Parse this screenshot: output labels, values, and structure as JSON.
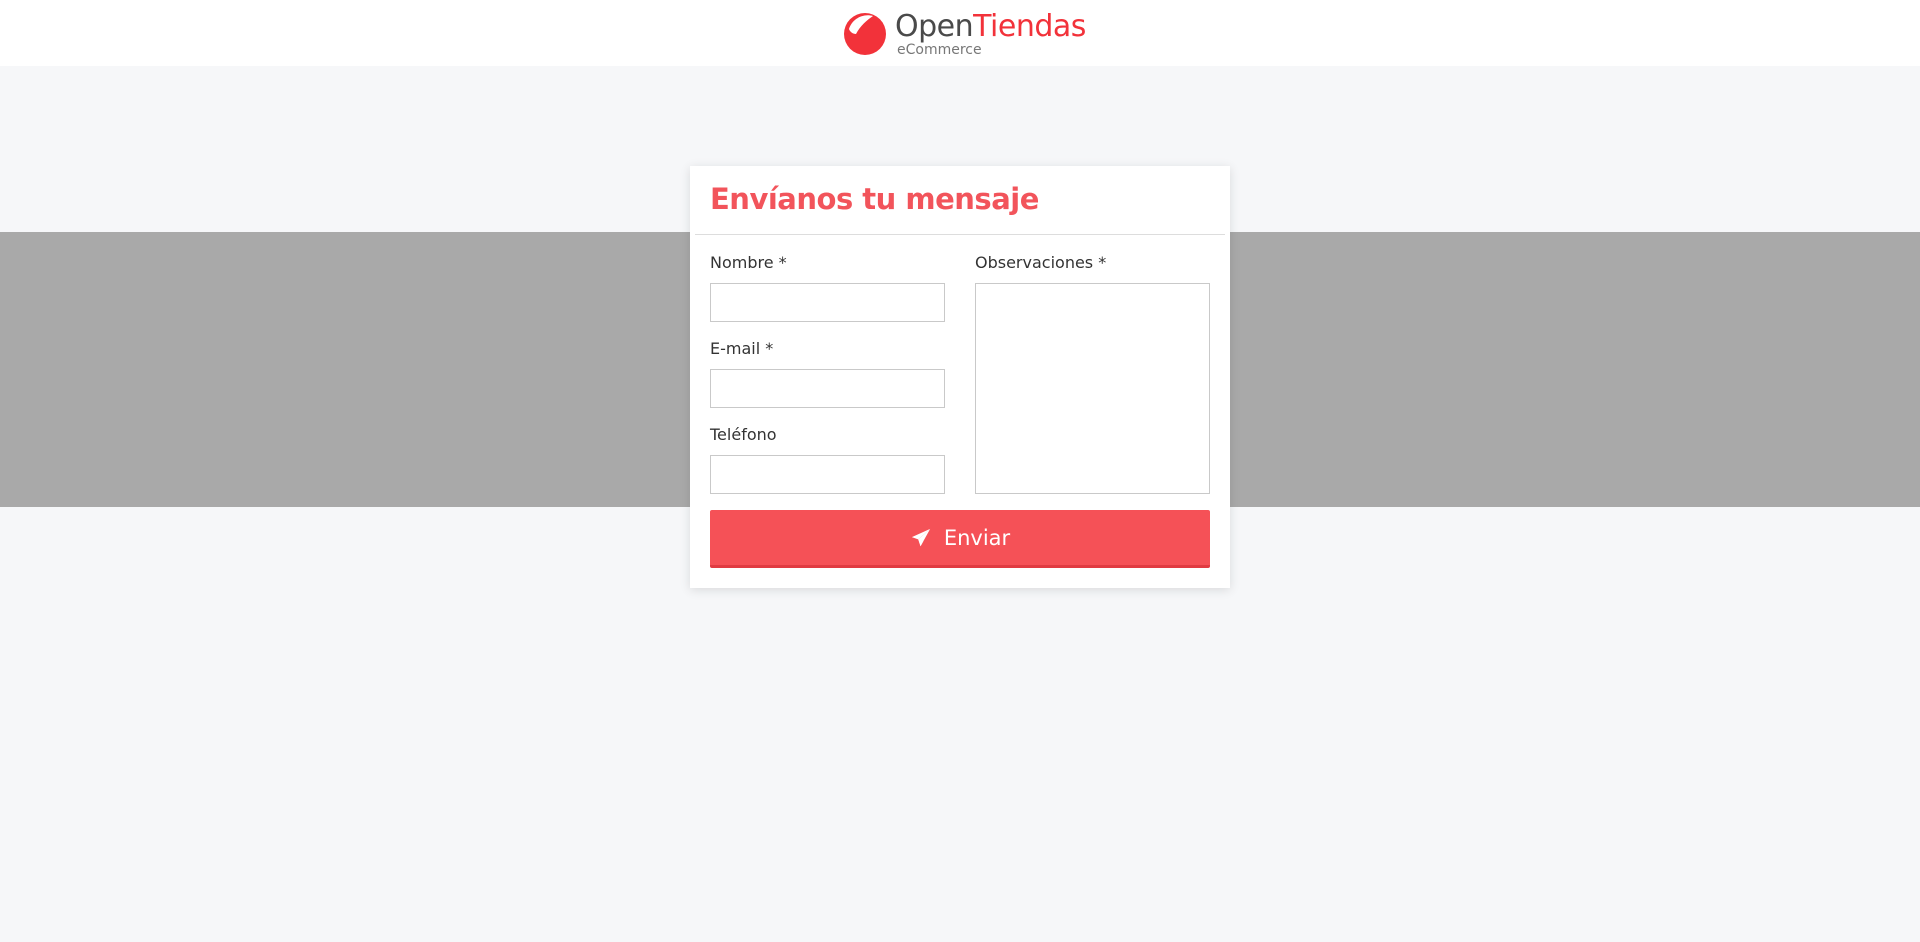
{
  "header": {
    "logo": {
      "name_part1": "Open",
      "name_part2": "Tiendas",
      "tagline": "eCommerce",
      "icon": "logo-mark",
      "colors": {
        "brand_red": "#f2323a",
        "text_dark": "#4a4a4a"
      }
    }
  },
  "form": {
    "title": "Envíanos tu mensaje",
    "fields": {
      "nombre": {
        "label": "Nombre *",
        "value": "",
        "placeholder": ""
      },
      "email": {
        "label": "E-mail *",
        "value": "",
        "placeholder": ""
      },
      "telefono": {
        "label": "Teléfono",
        "value": "",
        "placeholder": ""
      },
      "observaciones": {
        "label": "Observaciones *",
        "value": "",
        "placeholder": ""
      }
    },
    "submit": {
      "label": "Enviar",
      "icon": "paper-plane-icon"
    }
  },
  "colors": {
    "accent": "#f55157",
    "title": "#f2545b",
    "page_background": "#f6f7f9",
    "band_background": "#a9a9a9"
  }
}
